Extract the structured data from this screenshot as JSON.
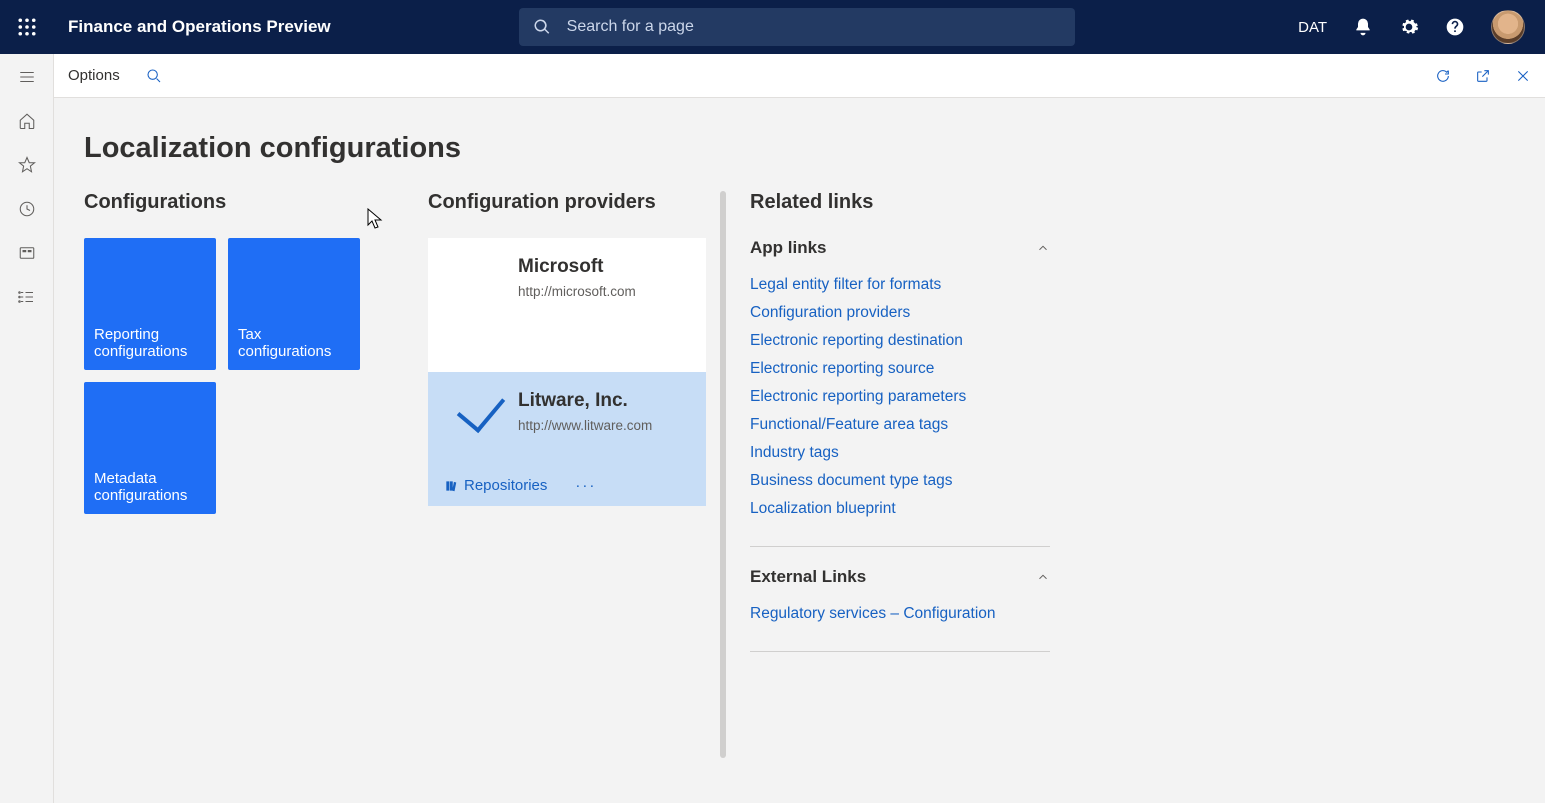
{
  "header": {
    "app_title": "Finance and Operations Preview",
    "search_placeholder": "Search for a page",
    "company": "DAT"
  },
  "actionbar": {
    "options_label": "Options"
  },
  "page": {
    "title": "Localization configurations",
    "configs_label": "Configurations",
    "providers_label": "Configuration providers",
    "related_label": "Related links"
  },
  "tiles": [
    "Reporting configurations",
    "Tax configurations",
    "Metadata configurations"
  ],
  "providers": [
    {
      "name": "Microsoft",
      "url": "http://microsoft.com",
      "selected": false
    },
    {
      "name": "Litware, Inc.",
      "url": "http://www.litware.com",
      "selected": true,
      "repositories_label": "Repositories"
    }
  ],
  "related": {
    "app_links_label": "App links",
    "app_links": [
      "Legal entity filter for formats",
      "Configuration providers",
      "Electronic reporting destination",
      "Electronic reporting source",
      "Electronic reporting parameters",
      "Functional/Feature area tags",
      "Industry tags",
      "Business document type tags",
      "Localization blueprint"
    ],
    "external_links_label": "External Links",
    "external_links": [
      "Regulatory services – Configuration"
    ]
  }
}
